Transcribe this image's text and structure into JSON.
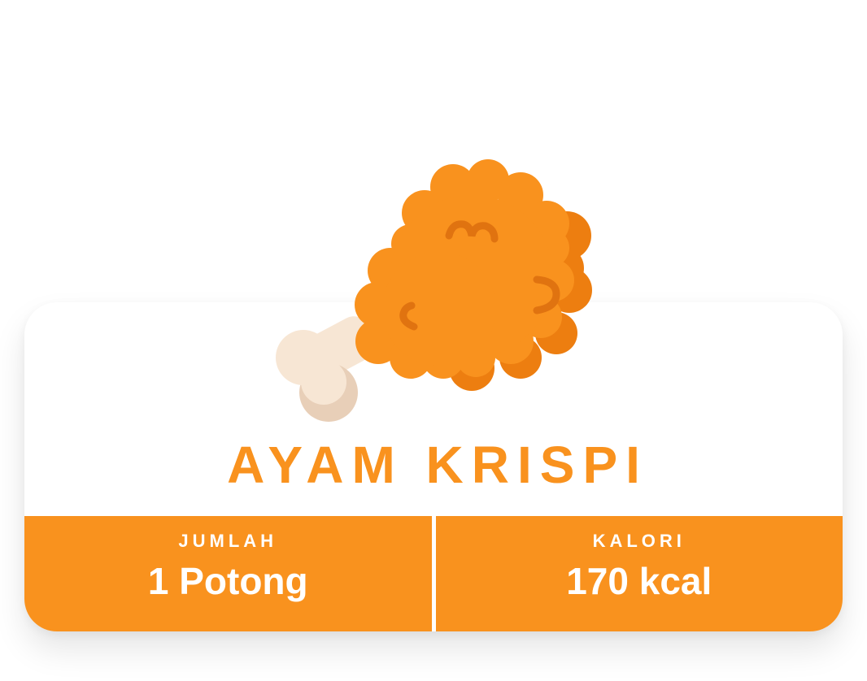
{
  "card": {
    "title": "AYAM KRISPI",
    "icon": "fried-chicken-drumstick-icon",
    "accent_color": "#f9921e"
  },
  "stats": [
    {
      "label": "JUMLAH",
      "value": "1 Potong"
    },
    {
      "label": "KALORI",
      "value": "170 kcal"
    }
  ]
}
